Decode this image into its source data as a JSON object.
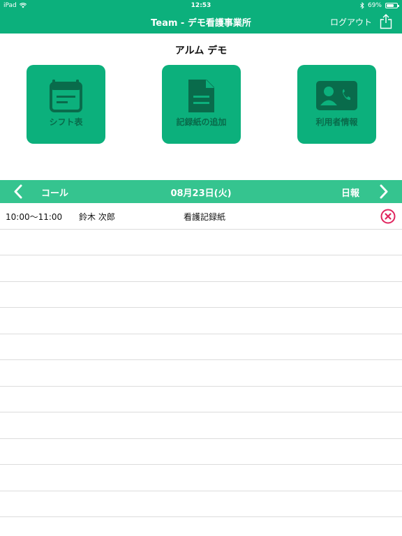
{
  "status_bar": {
    "carrier": "iPad",
    "time": "12:53",
    "battery_percent": "69%",
    "battery_level": 0.69
  },
  "nav": {
    "title": "Team - デモ看護事業所",
    "logout_label": "ログアウト"
  },
  "user_name": "アルム デモ",
  "tiles": [
    {
      "label": "シフト表",
      "icon": "calendar-icon"
    },
    {
      "label": "記録紙の追加",
      "icon": "document-icon"
    },
    {
      "label": "利用者情報",
      "icon": "contact-card-icon"
    }
  ],
  "date_bar": {
    "left_label": "コール",
    "date": "08月23日(火)",
    "right_label": "日報"
  },
  "records": [
    {
      "time": "10:00〜11:00",
      "name": "鈴木 次郎",
      "type": "看護記録紙"
    }
  ],
  "colors": {
    "primary": "#0cb07c",
    "date_bar": "#35c48f",
    "tile_text": "#096b4b",
    "delete": "#e0245e"
  }
}
